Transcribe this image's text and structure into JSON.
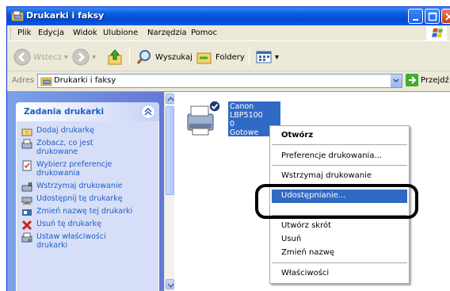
{
  "window": {
    "title": "Drukarki i faksy"
  },
  "menu": [
    "Plik",
    "Edycja",
    "Widok",
    "Ulubione",
    "Narzędzia",
    "Pomoc"
  ],
  "toolbar": {
    "back": "Wstecz",
    "search": "Wyszukaj",
    "folders": "Foldery"
  },
  "address": {
    "label": "Adres",
    "value": "Drukarki i faksy",
    "go": "Przejdź"
  },
  "tasks": {
    "header": "Zadania drukarki",
    "items": [
      "Dodaj drukarkę",
      "Zobacz, co jest drukowane",
      "Wybierz preferencje drukowania",
      "Wstrzymaj drukowanie",
      "Udostępnij tę drukarkę",
      "Zmień nazwę tej drukarki",
      "Usuń tę drukarkę",
      "Ustaw właściwości drukarki"
    ]
  },
  "printer": {
    "name": "Canon LBP5100",
    "docs": "0",
    "status": "Gotowe"
  },
  "context_menu": {
    "items": [
      "Otwórz",
      "Preferencje drukowania...",
      "Wstrzymaj drukowanie",
      "Udostępnianie...",
      "Utwórz skrót",
      "Usuń",
      "Zmień nazwę",
      "Właściwości"
    ],
    "highlighted": "Udostępnianie..."
  },
  "colors": {
    "titlebar": "#0a5ee0",
    "selection": "#316ac5",
    "task_link": "#215dc6"
  }
}
